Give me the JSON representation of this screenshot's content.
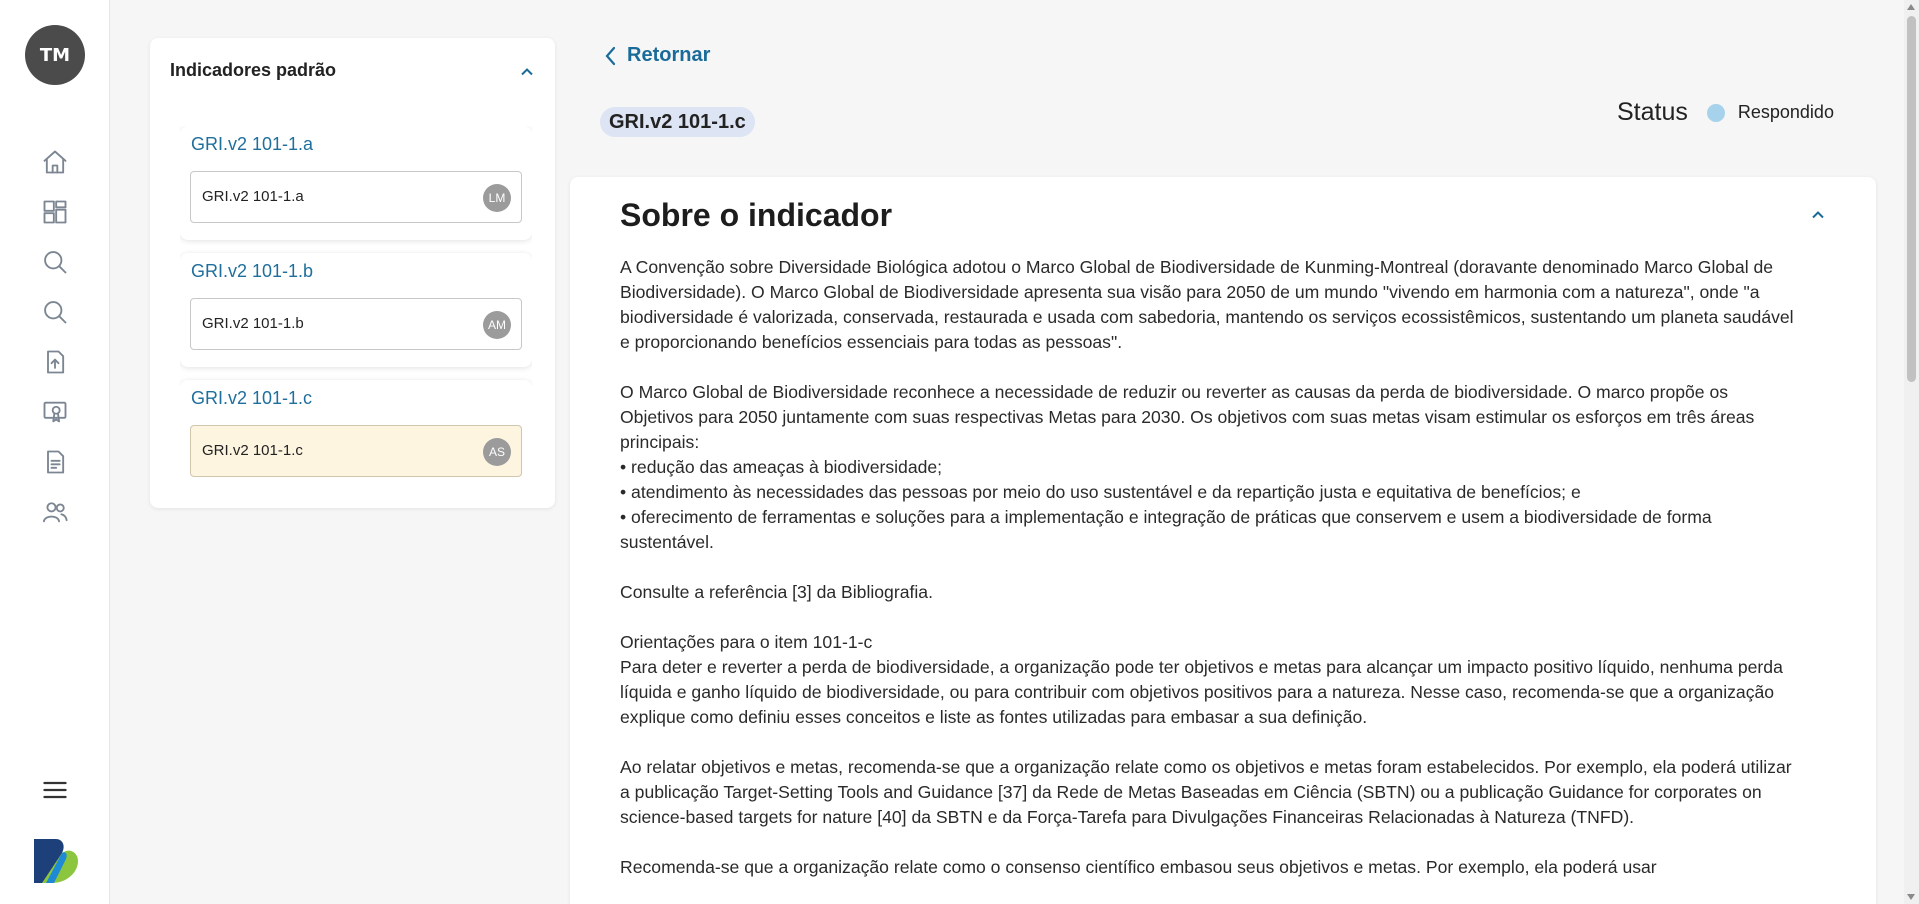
{
  "user": {
    "initials": "TM"
  },
  "nav": {
    "items": [
      {
        "icon": "home-icon"
      },
      {
        "icon": "dashboard-icon"
      },
      {
        "icon": "search-icon"
      },
      {
        "icon": "search-icon"
      },
      {
        "icon": "file-upload-icon"
      },
      {
        "icon": "certificate-icon"
      },
      {
        "icon": "report-icon"
      },
      {
        "icon": "users-icon"
      }
    ],
    "menu_icon": "menu-icon",
    "logo": "brand-logo"
  },
  "indicators": {
    "title": "Indicadores padrão",
    "items": [
      {
        "title": "GRI.v2 101-1.a",
        "field": "GRI.v2 101-1.a",
        "badge": "LM",
        "active": false
      },
      {
        "title": "GRI.v2 101-1.b",
        "field": "GRI.v2 101-1.b",
        "badge": "AM",
        "active": false
      },
      {
        "title": "GRI.v2 101-1.c",
        "field": "GRI.v2 101-1.c",
        "badge": "AS",
        "active": true
      }
    ]
  },
  "main": {
    "back_label": "Retornar",
    "code": "GRI.v2 101-1.c",
    "status": {
      "label": "Status",
      "value": "Respondido",
      "dot_color": "#a7d2ec"
    },
    "about": {
      "title": "Sobre o indicador",
      "paragraphs": [
        [
          "A Convenção sobre Diversidade Biológica adotou o Marco Global de Biodiversidade de Kunming-Montreal (doravante denominado Marco Global de Biodiversidade). O Marco Global de Biodiversidade apresenta sua visão para 2050 de um mundo \"vivendo em harmonia com a natureza\", onde \"a biodiversidade é valorizada, conservada, restaurada e usada com sabedoria, mantendo os serviços ecossistêmicos, sustentando um planeta saudável e proporcionando benefícios essenciais para todas as pessoas\"."
        ],
        [
          "O Marco Global de Biodiversidade reconhece a necessidade de reduzir ou reverter as causas da perda de biodiversidade. O marco propõe os Objetivos para 2050 juntamente com suas respectivas Metas para 2030. Os objetivos com suas metas visam estimular os esforços em três áreas principais:",
          "• redução das ameaças à biodiversidade;",
          "• atendimento às necessidades das pessoas por meio do uso sustentável e da repartição justa e equitativa de benefícios; e",
          "• oferecimento de ferramentas e soluções para a implementação e integração de práticas que conservem e usem a biodiversidade de forma sustentável."
        ],
        [
          "Consulte a referência [3] da Bibliografia."
        ],
        [
          "Orientações para o item 101-1-c",
          "Para deter e reverter a perda de biodiversidade, a organização pode ter objetivos e metas para alcançar um impacto positivo líquido, nenhuma perda líquida e ganho líquido de biodiversidade, ou para contribuir com objetivos positivos para a natureza. Nesse caso, recomenda-se que a organização explique como definiu esses conceitos e liste as fontes utilizadas para embasar a sua definição."
        ],
        [
          "Ao relatar objetivos e metas, recomenda-se que a organização relate como os objetivos e metas foram estabelecidos. Por exemplo, ela poderá utilizar a publicação Target-Setting Tools and Guidance [37] da Rede de Metas Baseadas em Ciência (SBTN) ou a publicação Guidance for corporates on science-based targets for nature [40] da SBTN e da Força-Tarefa para Divulgações Financeiras Relacionadas à Natureza (TNFD)."
        ],
        [
          "Recomenda-se que a organização relate como o consenso científico embasou seus objetivos e metas. Por exemplo, ela poderá usar"
        ]
      ]
    }
  }
}
